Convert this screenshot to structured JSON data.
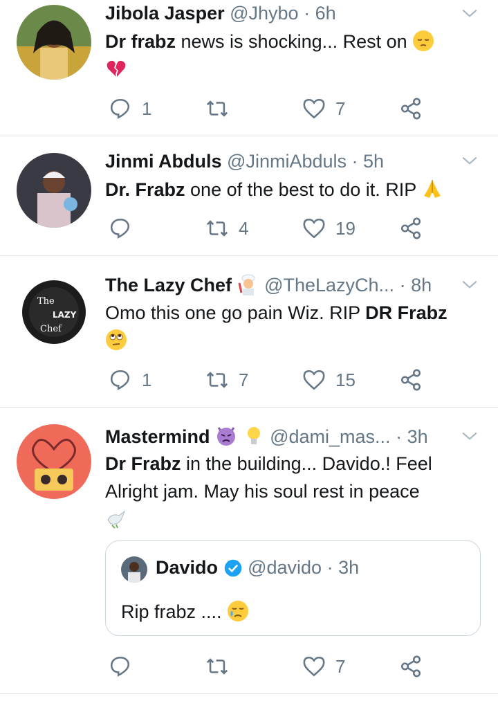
{
  "colors": {
    "text": "#14171a",
    "secondary": "#657786",
    "divider": "#e1e8ed",
    "verified": "#1da1f2"
  },
  "tweets": [
    {
      "name": "Jibola Jasper",
      "handle": "@Jhybo",
      "dot": "·",
      "time": "6h",
      "bold": "Dr frabz",
      "text": " news is shocking... Rest on ",
      "emojis": [
        "pensive-face",
        "broken-heart"
      ],
      "reply_count": "1",
      "retweet_count": "",
      "like_count": "7"
    },
    {
      "name": "Jinmi Abduls",
      "handle": "@JinmiAbduls",
      "dot": "·",
      "time": "5h",
      "bold": "Dr. Frabz",
      "text": " one of the best to do it. RIP ",
      "emojis": [
        "folded-hands"
      ],
      "reply_count": "",
      "retweet_count": "4",
      "like_count": "19"
    },
    {
      "name": "The Lazy Chef",
      "handle": "@TheLazyCh...",
      "dot": "·",
      "time": "8h",
      "text": "Omo this one go pain Wiz. RIP ",
      "bold": "DR Frabz",
      "emojis": [
        "cook",
        "face-with-rolling-eyes"
      ],
      "reply_count": "1",
      "retweet_count": "7",
      "like_count": "15"
    },
    {
      "name": "Mastermind",
      "handle": "@dami_mas...",
      "dot": "·",
      "time": "3h",
      "bold": "Dr Frabz",
      "text_line1": " in the building... Davido.! Feel",
      "text_line2": "Alright jam. May his soul rest in peace",
      "emojis": [
        "angry-devil",
        "light-bulb",
        "dove"
      ],
      "quote": {
        "name": "Davido",
        "handle": "@davido",
        "dot": "·",
        "time": "3h",
        "text": "Rip frabz .... ",
        "emoji": "crying-face"
      },
      "reply_count": "",
      "retweet_count": "",
      "like_count": "7"
    }
  ]
}
